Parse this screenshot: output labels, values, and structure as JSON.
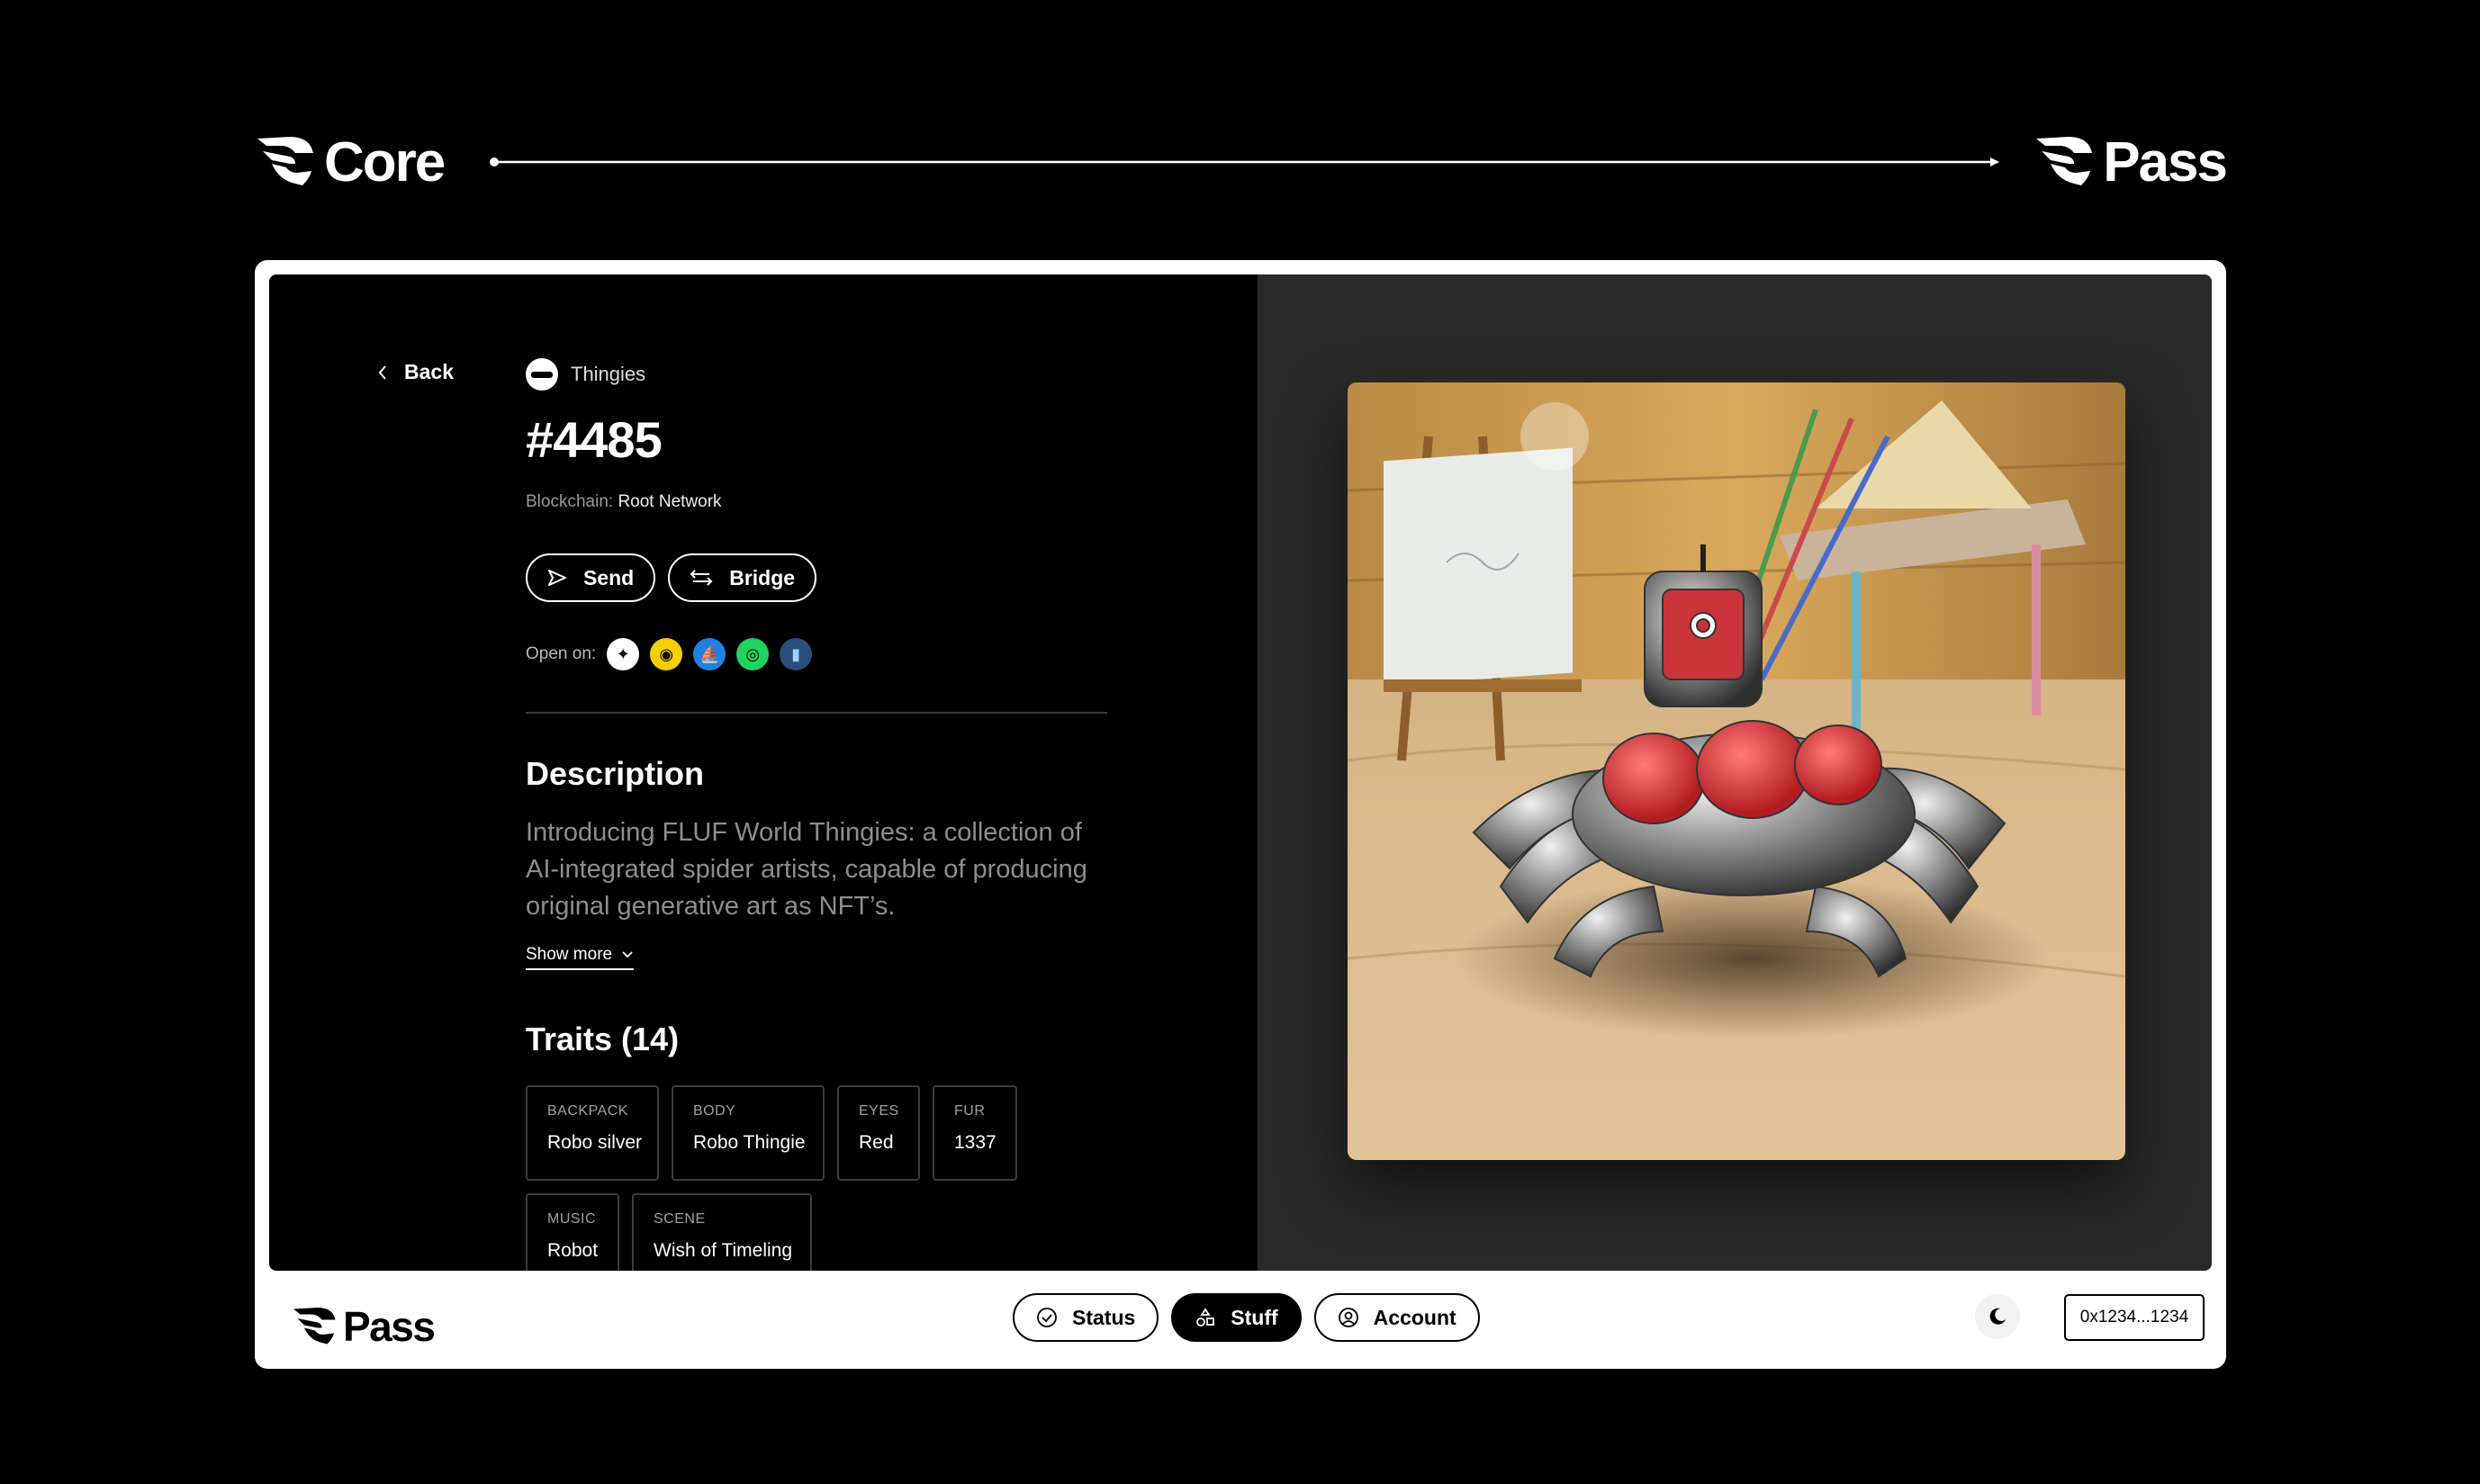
{
  "header": {
    "left_brand": "Core",
    "right_brand": "Pass",
    "left_logo_icon": "pass-logo-icon",
    "right_logo_icon": "pass-logo-icon"
  },
  "detail": {
    "back_label": "Back",
    "collection_name": "Thingies",
    "token_title": "#4485",
    "blockchain_label": "Blockchain:",
    "blockchain_value": "Root Network",
    "actions": {
      "send_label": "Send",
      "bridge_label": "Bridge"
    },
    "open_on_label": "Open on:",
    "marketplaces": [
      {
        "icon": "marketplace-1-icon",
        "color": "#ffffff"
      },
      {
        "icon": "marketplace-2-icon",
        "color": "#f5cf00"
      },
      {
        "icon": "opensea-icon",
        "color": "#2081e2"
      },
      {
        "icon": "marketplace-4-icon",
        "color": "#1fd15f"
      },
      {
        "icon": "marketplace-5-icon",
        "color": "#2a4f7a"
      }
    ],
    "description_title": "Description",
    "description_lines": [
      "Introducing FLUF World Thingies: a collection of",
      "AI-integrated spider artists, capable of producing",
      "original generative art as NFT’s."
    ],
    "show_more_label": "Show more",
    "traits_title": "Traits (14)",
    "traits": [
      {
        "type": "BACKPACK",
        "value": "Robo silver"
      },
      {
        "type": "BODY",
        "value": "Robo Thingie"
      },
      {
        "type": "EYES",
        "value": "Red"
      },
      {
        "type": "FUR",
        "value": "1337"
      },
      {
        "type": "MUSIC",
        "value": "Robot"
      },
      {
        "type": "SCENE",
        "value": "Wish of Timeling"
      }
    ]
  },
  "footer": {
    "brand": "Pass",
    "nav": [
      {
        "label": "Status",
        "icon": "status-check-icon",
        "active": false
      },
      {
        "label": "Stuff",
        "icon": "shapes-icon",
        "active": true
      },
      {
        "label": "Account",
        "icon": "user-circle-icon",
        "active": false
      }
    ],
    "theme_icon": "moon-icon",
    "wallet_address": "0x1234...1234"
  },
  "colors": {
    "page_bg": "#000000",
    "frame_bg": "#ffffff",
    "panel_dark": "#000000",
    "panel_media": "#2a2a2a",
    "muted_text": "#8e8e8e",
    "accent_red": "#e03a3e"
  }
}
